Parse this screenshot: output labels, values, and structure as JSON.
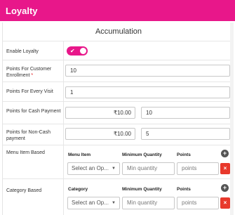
{
  "header": {
    "title": "Loyalty"
  },
  "section": {
    "title": "Accumulation"
  },
  "enable_loyalty": {
    "label": "Enable Loyalty",
    "enabled": true
  },
  "enrollment": {
    "label": "Points For Customer Enrollment",
    "required_mark": "*",
    "value": "10"
  },
  "every_visit": {
    "label": "Points For Every Visit",
    "value": "1"
  },
  "cash_payment": {
    "label": "Points for Cash Payment",
    "amount": "₹10.00",
    "points": "10"
  },
  "non_cash_payment": {
    "label": "Points for Non-Cash payment",
    "amount": "₹10.00",
    "points": "5"
  },
  "menu_item_based": {
    "label": "Menu Item Based",
    "col_item": "Menu Item",
    "col_min_qty": "Minimum Quantity",
    "col_points": "Points",
    "select_value": "Select an Op...",
    "min_qty_placeholder": "Min quantity",
    "points_placeholder": "points"
  },
  "category_based": {
    "label": "Category Based",
    "col_item": "Category",
    "col_min_qty": "Minimum Quantity",
    "col_points": "Points",
    "select_value": "Select an Op...",
    "min_qty_placeholder": "Min quantity",
    "points_placeholder": "points"
  },
  "icons": {
    "add": "plus-icon",
    "remove": "close-icon",
    "toggle_check": "checkmark-icon",
    "caret": "caret-down-icon"
  },
  "glyphs": {
    "add": "+",
    "remove": "×",
    "check": "✔",
    "caret": "▼"
  },
  "colors": {
    "brand": "#e8178a",
    "remove": "#e8392c",
    "add": "#555555"
  }
}
